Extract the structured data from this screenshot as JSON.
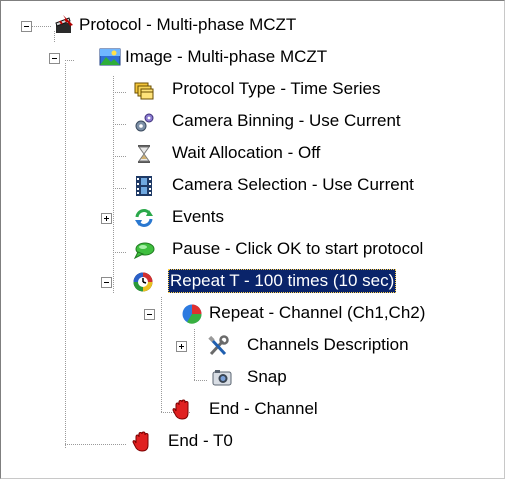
{
  "tree": {
    "items": [
      {
        "label": "Protocol - Multi-phase MCZT",
        "icon": "protocol-clapper-icon"
      },
      {
        "label": "Image - Multi-phase MCZT",
        "icon": "image-landscape-icon"
      },
      {
        "label": "Protocol Type - Time Series",
        "icon": "film-stack-icon"
      },
      {
        "label": "Camera Binning - Use Current",
        "icon": "gears-icon"
      },
      {
        "label": "Wait Allocation - Off",
        "icon": "hourglass-icon"
      },
      {
        "label": "Camera Selection - Use Current",
        "icon": "film-strip-icon"
      },
      {
        "label": "Events",
        "icon": "refresh-arrows-icon"
      },
      {
        "label": "Pause - Click OK to start protocol",
        "icon": "speech-bubble-icon"
      },
      {
        "label": "Repeat T - 100 times (10 sec)",
        "icon": "clock-icon",
        "selected": true
      },
      {
        "label": "Repeat - Channel (Ch1,Ch2)",
        "icon": "channel-pie-icon"
      },
      {
        "label": "Channels Description",
        "icon": "tools-icon"
      },
      {
        "label": "Snap",
        "icon": "camera-icon"
      },
      {
        "label": "End - Channel",
        "icon": "stop-hand-icon"
      },
      {
        "label": "End - T0",
        "icon": "stop-hand-icon"
      }
    ]
  },
  "colors": {
    "selection_bg": "#0a246a",
    "selection_text": "#ffffff",
    "tree_lines": "#9a9a9a"
  }
}
